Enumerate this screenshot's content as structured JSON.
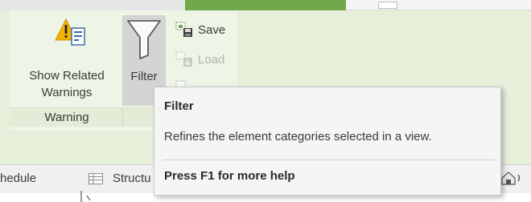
{
  "ribbon": {
    "buttons": {
      "show_related_warnings": {
        "label_line1": "Show Related",
        "label_line2": "Warnings",
        "icon": "warning-icon"
      },
      "filter": {
        "label": "Filter",
        "icon": "funnel-icon"
      },
      "save": {
        "label": "Save",
        "icon": "save-selection-icon"
      },
      "load": {
        "label": "Load",
        "icon": "load-selection-icon",
        "enabled": false
      }
    },
    "groups": {
      "warning": "Warning"
    }
  },
  "tooltip": {
    "title": "Filter",
    "description": "Refines the element categories selected in a view.",
    "help": "Press F1 for more help"
  },
  "view_tabs": {
    "schedule": "hedule",
    "structural": "Structu"
  },
  "colors": {
    "ribbon_bg": "#e6efd9",
    "accent_green": "#6fa94a",
    "tooltip_bg": "#f5f5f5"
  }
}
